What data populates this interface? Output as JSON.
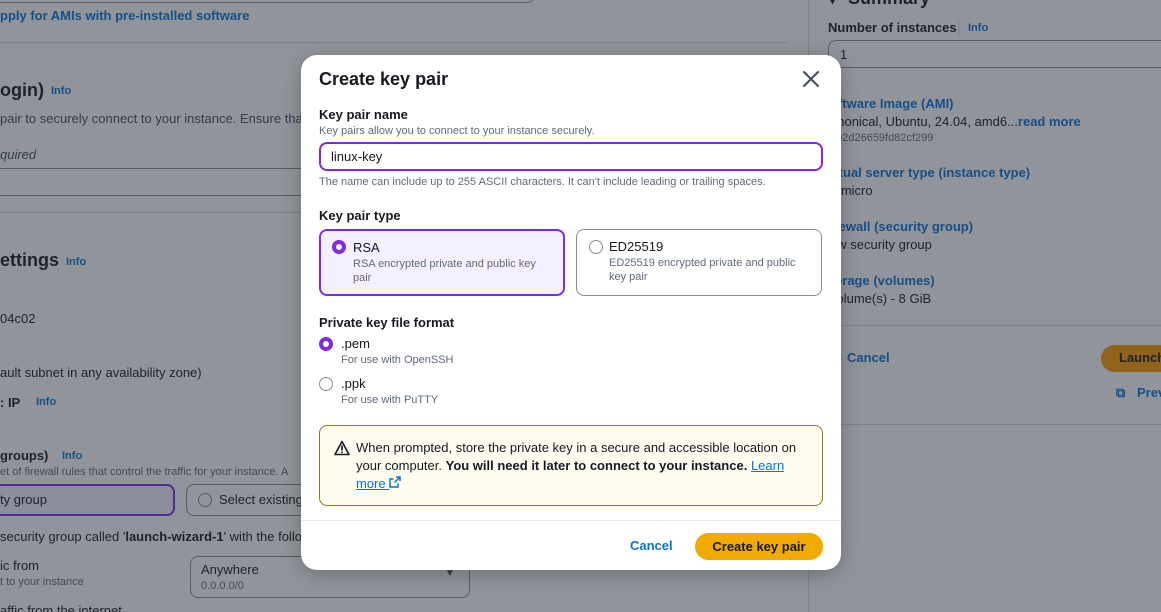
{
  "background": {
    "ami_link": "pply for AMIs with pre-installed software",
    "keypair_section": {
      "title": "ogin)",
      "info": "Info",
      "desc": "pair to securely connect to your instance. Ensure that",
      "required": "quired"
    },
    "network_section": {
      "title": "ettings",
      "info": "Info",
      "vpc": "04c02",
      "subnet": "ault subnet in any availability zone)",
      "ip_label": ": IP",
      "ip_info": "Info"
    },
    "sg_section": {
      "title": "groups)",
      "info": "Info",
      "desc": "et of firewall rules that control the traffic for your instance. A",
      "create_option": "ty group",
      "select_option": "Select existing",
      "note_prefix": "security group called '",
      "note_name": "launch-wizard-1",
      "note_suffix": "' with the follo",
      "traffic_label": "ic from",
      "traffic_desc": "t to your instance",
      "source_value": "Anywhere",
      "source_sub": "0.0.0.0/0",
      "internet_partial": "affic from the internet"
    },
    "summary": {
      "title": "Summary",
      "instances_label": "Number of instances",
      "instances_info": "Info",
      "instances_value": "1",
      "ami_label": "oftware Image (AMI)",
      "ami_value": "anonical, Ubuntu, 24.04, amd6...",
      "ami_read_more": "read more",
      "ami_id": "i-02d26659fd82cf299",
      "type_label": "irtual server type (instance type)",
      "type_value": "2.micro",
      "firewall_label": "irewall (security group)",
      "firewall_value": "ew security group",
      "storage_label": "torage (volumes)",
      "storage_value": "volume(s) - 8 GiB",
      "cancel": "Cancel",
      "launch": "Launch",
      "preview": "Prev"
    }
  },
  "modal": {
    "title": "Create key pair",
    "name_label": "Key pair name",
    "name_desc": "Key pairs allow you to connect to your instance securely.",
    "name_value": "linux-key",
    "name_hint": "The name can include up to 255 ASCII characters. It can't include leading or trailing spaces.",
    "type_label": "Key pair type",
    "types": [
      {
        "title": "RSA",
        "desc": "RSA encrypted private and public key pair",
        "selected": true
      },
      {
        "title": "ED25519",
        "desc": "ED25519 encrypted private and public key pair",
        "selected": false
      }
    ],
    "format_label": "Private key file format",
    "formats": [
      {
        "title": ".pem",
        "desc": "For use with OpenSSH",
        "selected": true
      },
      {
        "title": ".ppk",
        "desc": "For use with PuTTY",
        "selected": false
      }
    ],
    "alert": {
      "text": "When prompted, store the private key in a secure and accessible location on your computer. ",
      "bold": "You will need it later to connect to your instance.",
      "learn_more": "Learn more"
    },
    "cancel": "Cancel",
    "submit": "Create key pair"
  },
  "colors": {
    "accent": "#7d2ae8",
    "link": "#0972d3",
    "primary_button": "#f2a900",
    "alert_bg": "#fffdf0"
  }
}
